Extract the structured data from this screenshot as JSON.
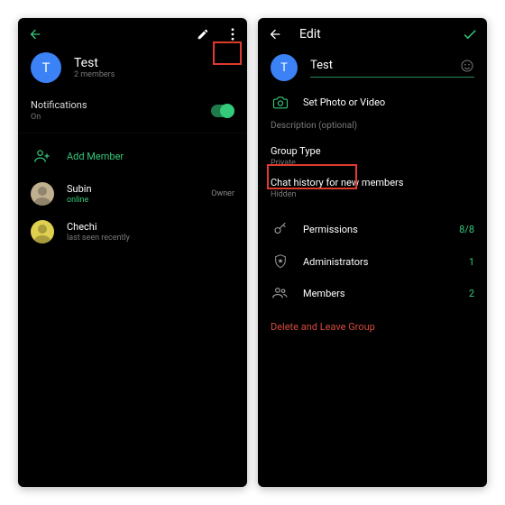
{
  "left": {
    "group_name": "Test",
    "member_count": "2 members",
    "notifications_label": "Notifications",
    "notifications_state": "On",
    "add_member": "Add Member",
    "members": [
      {
        "name": "Subin",
        "status": "online",
        "status_green": true,
        "role": "Owner",
        "avatar_color": "#c0b090"
      },
      {
        "name": "Chechi",
        "status": "last seen recently",
        "status_green": false,
        "role": "",
        "avatar_color": "#e0d050"
      }
    ],
    "avatar_letter": "T"
  },
  "right": {
    "header_title": "Edit",
    "avatar_letter": "T",
    "group_name": "Test",
    "set_photo": "Set Photo or Video",
    "description": "Description (optional)",
    "group_type_label": "Group Type",
    "group_type_value": "Private",
    "history_label": "Chat history for new members",
    "history_value": "Hidden",
    "permissions_label": "Permissions",
    "permissions_value": "8/8",
    "admins_label": "Administrators",
    "admins_value": "1",
    "members_label": "Members",
    "members_value": "2",
    "delete_label": "Delete and Leave Group"
  }
}
